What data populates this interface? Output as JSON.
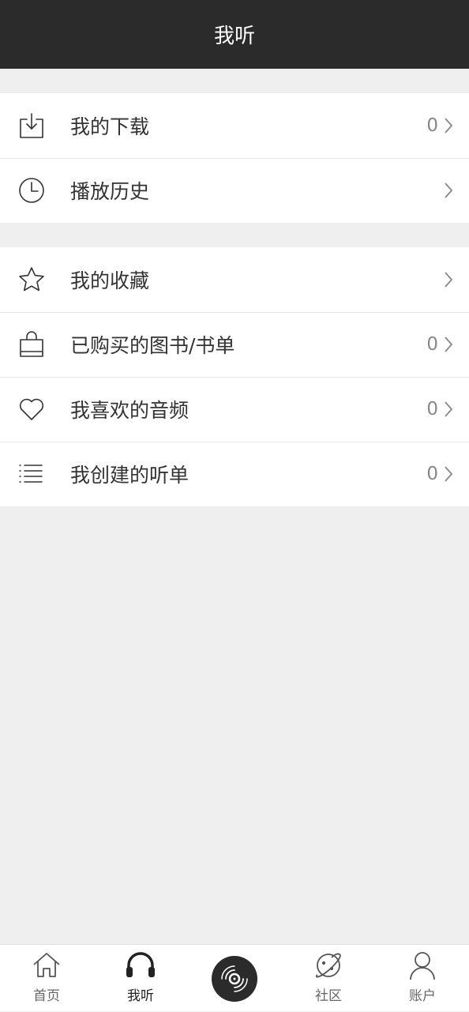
{
  "header": {
    "title": "我听"
  },
  "group1": [
    {
      "icon": "download-icon",
      "label": "我的下载",
      "count": "0"
    },
    {
      "icon": "clock-icon",
      "label": "播放历史",
      "count": ""
    }
  ],
  "group2": [
    {
      "icon": "star-icon",
      "label": "我的收藏",
      "count": ""
    },
    {
      "icon": "shopping-bag-icon",
      "label": "已购买的图书/书单",
      "count": "0"
    },
    {
      "icon": "heart-icon",
      "label": "我喜欢的音频",
      "count": "0"
    },
    {
      "icon": "list-icon",
      "label": "我创建的听单",
      "count": "0"
    }
  ],
  "tabbar": {
    "home": {
      "icon": "home-icon",
      "label": "首页"
    },
    "listen": {
      "icon": "headphones-icon",
      "label": "我听"
    },
    "player": {
      "icon": "vinyl-record-icon"
    },
    "community": {
      "icon": "planet-icon",
      "label": "社区"
    },
    "account": {
      "icon": "person-icon",
      "label": "账户"
    }
  },
  "colors": {
    "header_bg": "#2b2b2b",
    "page_bg": "#efefef",
    "row_bg": "#ffffff",
    "text": "#333333",
    "muted": "#888888"
  }
}
